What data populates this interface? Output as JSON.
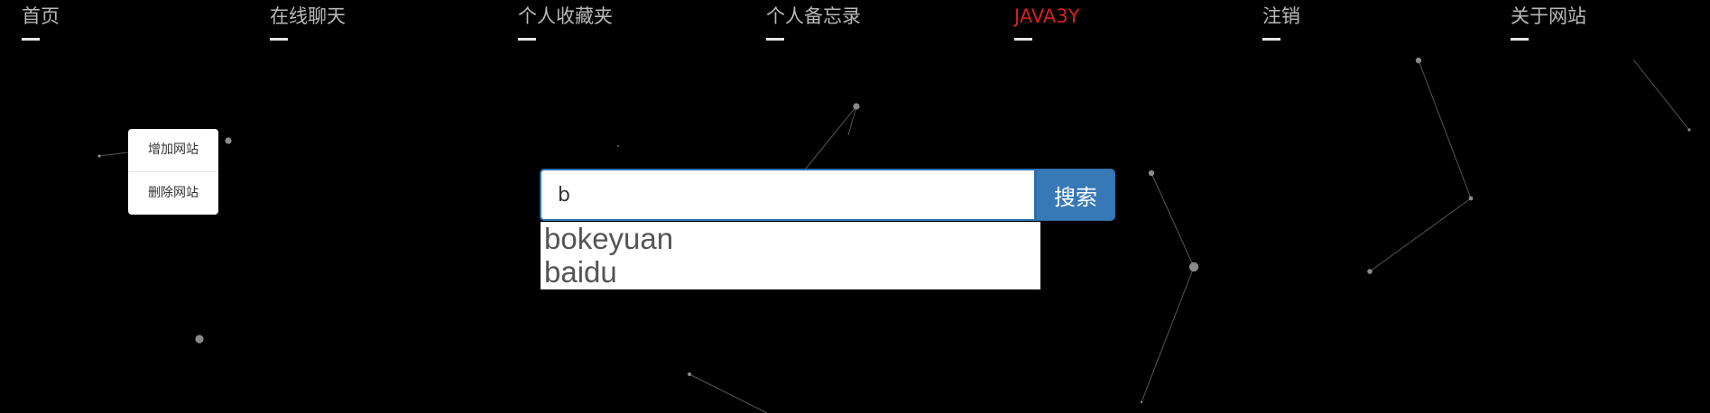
{
  "nav": {
    "items": [
      {
        "label": "首页",
        "active": false
      },
      {
        "label": "在线聊天",
        "active": false
      },
      {
        "label": "个人收藏夹",
        "active": false
      },
      {
        "label": "个人备忘录",
        "active": false
      },
      {
        "label": "JAVA3Y",
        "active": true
      },
      {
        "label": "注销",
        "active": false
      },
      {
        "label": "关于网站",
        "active": false
      }
    ]
  },
  "context_menu": {
    "items": [
      {
        "label": "增加网站"
      },
      {
        "label": "删除网站"
      }
    ]
  },
  "search": {
    "value": "b",
    "button_label": "搜索",
    "suggestions": [
      "bokeyuan",
      "baidu"
    ]
  },
  "colors": {
    "background": "#000000",
    "nav_text": "#b9b9b9",
    "nav_active": "#d61f1f",
    "search_button": "#3778b7"
  }
}
